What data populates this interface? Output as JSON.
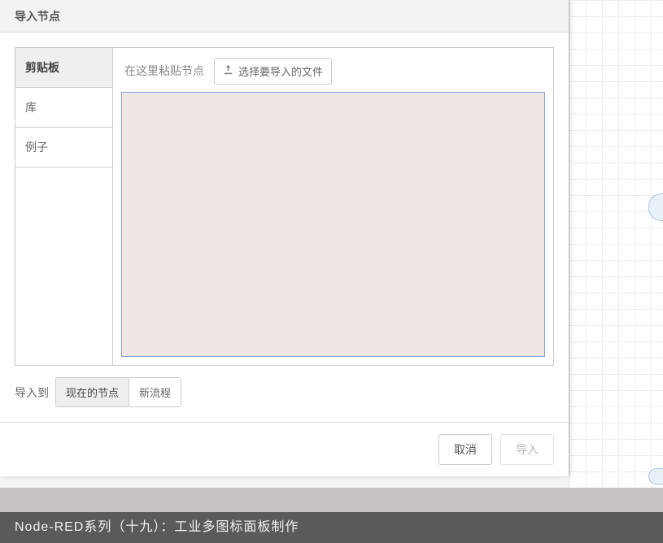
{
  "dialog": {
    "title": "导入节点",
    "tabs": {
      "clipboard": "剪贴板",
      "library": "库",
      "examples": "例子"
    },
    "paste_hint": "在这里粘贴节点",
    "file_button": "选择要导入的文件",
    "textarea_value": "",
    "dest": {
      "label": "导入到",
      "current_flow": "现在的节点",
      "new_flow": "新流程"
    },
    "footer": {
      "cancel": "取消",
      "import": "导入"
    }
  },
  "caption": "Node-RED系列（十九）：工业多图标面板制作"
}
